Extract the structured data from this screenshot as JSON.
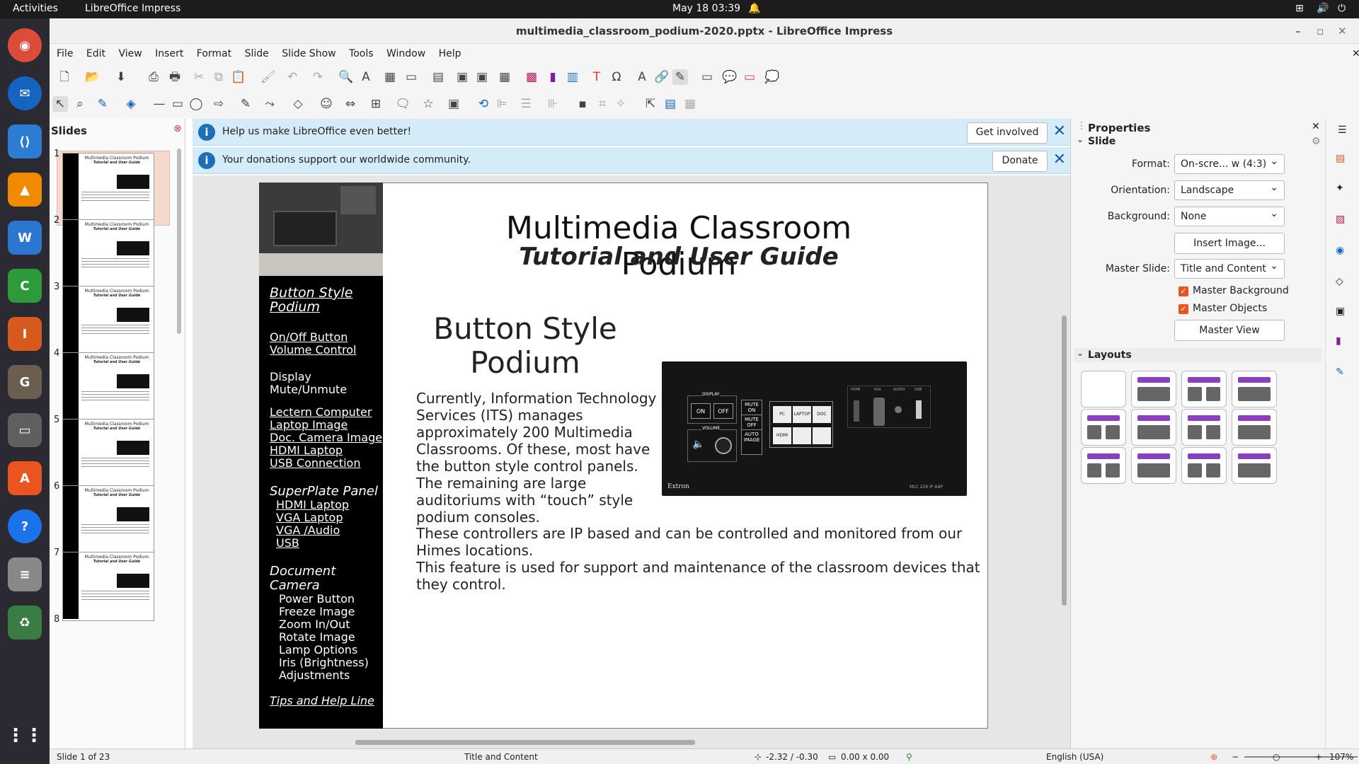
{
  "topbar": {
    "activities": "Activities",
    "app": "LibreOffice Impress",
    "datetime": "May 18  03:39"
  },
  "window": {
    "title": "multimedia_classroom_podium-2020.pptx - LibreOffice Impress"
  },
  "menu": [
    "File",
    "Edit",
    "View",
    "Insert",
    "Format",
    "Slide",
    "Slide Show",
    "Tools",
    "Window",
    "Help"
  ],
  "slides_pane": {
    "title": "Slides",
    "numbers": [
      "1",
      "2",
      "3",
      "4",
      "5",
      "6",
      "7",
      "8"
    ],
    "thumb_title": "Multimedia Classroom Podium",
    "thumb_sub": "Tutorial and User Guide"
  },
  "infobars": [
    {
      "text": "Help us make LibreOffice even better!",
      "button": "Get involved"
    },
    {
      "text": "Your donations support our worldwide community.",
      "button": "Donate"
    }
  ],
  "slide": {
    "title": "Multimedia Classroom Podium",
    "subtitle": "Tutorial and User Guide",
    "heading1": "Button Style",
    "heading2": "Podium",
    "body": "Currently, Information Technology Services (ITS) manages approximately 200 Multimedia Classrooms. Of these, most have the  button style control panels. The remaining are large auditoriums with “touch” style podium consoles.",
    "body2a": "These controllers are IP based and can be controlled and monitored from our Himes locations.",
    "body2b": "This feature is used for support and maintenance of the classroom devices that they control.",
    "panel": {
      "display": "DISPLAY",
      "on": "ON",
      "off": "OFF",
      "volume": "VOLUME",
      "mute_on": "MUTE ON",
      "mute_off": "MUTE OFF",
      "auto": "AUTO IMAGE",
      "pc": "PC",
      "laptop": "LAPTOP",
      "doccam": "DOC CAM",
      "hdmi": "HDMI",
      "brand": "Extron",
      "model": "MLC 226 IP AAP",
      "ports": [
        "HDMI",
        "VGA",
        "AUDIO",
        "USB"
      ]
    },
    "nav": {
      "section1": "Button Style Podium",
      "links1": [
        " On/Off Button",
        "Volume Control"
      ],
      "mute": "Display Mute/Unmute",
      "links2": [
        "Lectern Computer",
        " Laptop Image",
        "Doc. Camera Image",
        "HDMI Laptop",
        "USB Connection"
      ],
      "section2": "SuperPlate Panel",
      "links3": [
        "  HDMI Laptop",
        "  VGA Laptop",
        "  VGA /Audio",
        "  USB"
      ],
      "section3": "Document Camera",
      "items": [
        "  Power Button",
        "  Freeze Image",
        "  Zoom In/Out",
        "  Rotate Image",
        "  Lamp Options",
        "  Iris (Brightness)",
        "  Adjustments"
      ],
      "tips": "Tips and Help Line"
    }
  },
  "properties": {
    "title": "Properties",
    "section": "Slide",
    "format_label": "Format:",
    "format_value": "On-scre... w (4:3)",
    "orientation_label": "Orientation:",
    "orientation_value": "Landscape",
    "background_label": "Background:",
    "background_value": "None",
    "insert_image": "Insert Image...",
    "master_label": "Master Slide:",
    "master_value": "Title and Content",
    "master_bg": "Master Background",
    "master_obj": "Master Objects",
    "master_view": "Master View",
    "layouts": "Layouts"
  },
  "status": {
    "slide": "Slide 1 of 23",
    "layout": "Title and Content",
    "position": "-2.32 / -0.30",
    "size": "0.00 x 0.00",
    "language": "English (USA)",
    "zoom": "107%"
  },
  "colors": {
    "accent": "#8a3fc1",
    "infobar": "#d4ecf8",
    "selected": "#e95420"
  }
}
